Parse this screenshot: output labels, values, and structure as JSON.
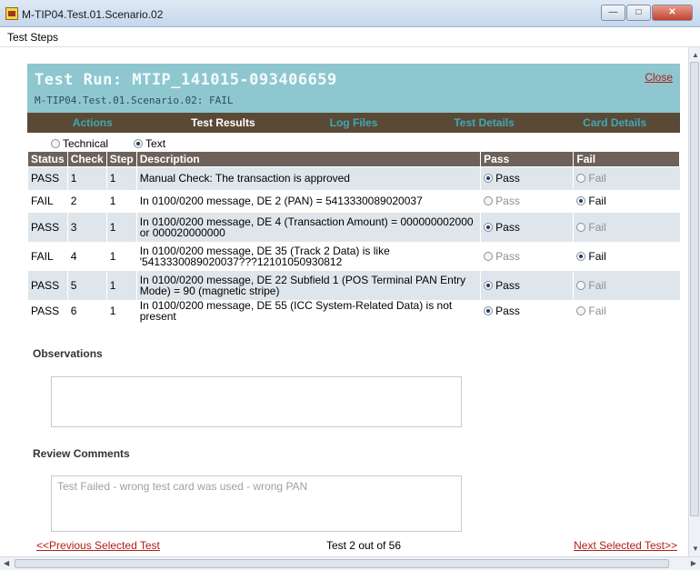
{
  "window": {
    "title": "M-TIP04.Test.01.Scenario.02",
    "min": "—",
    "max": "□",
    "close": "✕"
  },
  "menu": {
    "test_steps": "Test Steps"
  },
  "header": {
    "title": "Test Run: MTIP_141015-093406659",
    "subtitle": "M-TIP04.Test.01.Scenario.02: FAIL",
    "close_link": "Close"
  },
  "tabs": [
    {
      "label": "Actions"
    },
    {
      "label": "Test Results"
    },
    {
      "label": "Log Files"
    },
    {
      "label": "Test Details"
    },
    {
      "label": "Card Details"
    }
  ],
  "view_mode": {
    "options": [
      "Technical",
      "Text"
    ],
    "selected": "Text"
  },
  "table": {
    "headers": [
      "Status",
      "Check",
      "Step",
      "Description",
      "Pass",
      "Fail"
    ],
    "rows": [
      {
        "status": "PASS",
        "check": "1",
        "step": "1",
        "description": "Manual Check: The transaction is approved",
        "pass": "Pass",
        "fail": "Fail",
        "selected": "pass"
      },
      {
        "status": "FAIL",
        "check": "2",
        "step": "1",
        "description": "In 0100/0200 message, DE 2 (PAN) = 5413330089020037",
        "pass": "Pass",
        "fail": "Fail",
        "selected": "fail"
      },
      {
        "status": "PASS",
        "check": "3",
        "step": "1",
        "description": "In 0100/0200 message, DE 4 (Transaction Amount) = 000000002000 or 000020000000",
        "pass": "Pass",
        "fail": "Fail",
        "selected": "pass"
      },
      {
        "status": "FAIL",
        "check": "4",
        "step": "1",
        "description": "In 0100/0200 message, DE 35 (Track 2 Data) is like '5413330089020037???12101050930812",
        "pass": "Pass",
        "fail": "Fail",
        "selected": "fail"
      },
      {
        "status": "PASS",
        "check": "5",
        "step": "1",
        "description": "In 0100/0200 message, DE 22 Subfield 1 (POS Terminal PAN Entry Mode) = 90 (magnetic stripe)",
        "pass": "Pass",
        "fail": "Fail",
        "selected": "pass"
      },
      {
        "status": "PASS",
        "check": "6",
        "step": "1",
        "description": "In 0100/0200 message, DE 55 (ICC System-Related Data) is not present",
        "pass": "Pass",
        "fail": "Fail",
        "selected": "pass"
      }
    ]
  },
  "observations": {
    "label": "Observations",
    "value": ""
  },
  "review": {
    "label": "Review Comments",
    "value": "Test Failed - wrong test card was used - wrong PAN"
  },
  "footer": {
    "prev": "<<Previous Selected Test",
    "position": "Test 2 out of 56",
    "next": "Next Selected Test>>"
  },
  "colors": {
    "header_bg": "#8ec7cf",
    "tab_bg": "#5a4a35",
    "tab_text": "#3ea8b7",
    "table_header": "#6d6159",
    "link": "#b12018"
  }
}
